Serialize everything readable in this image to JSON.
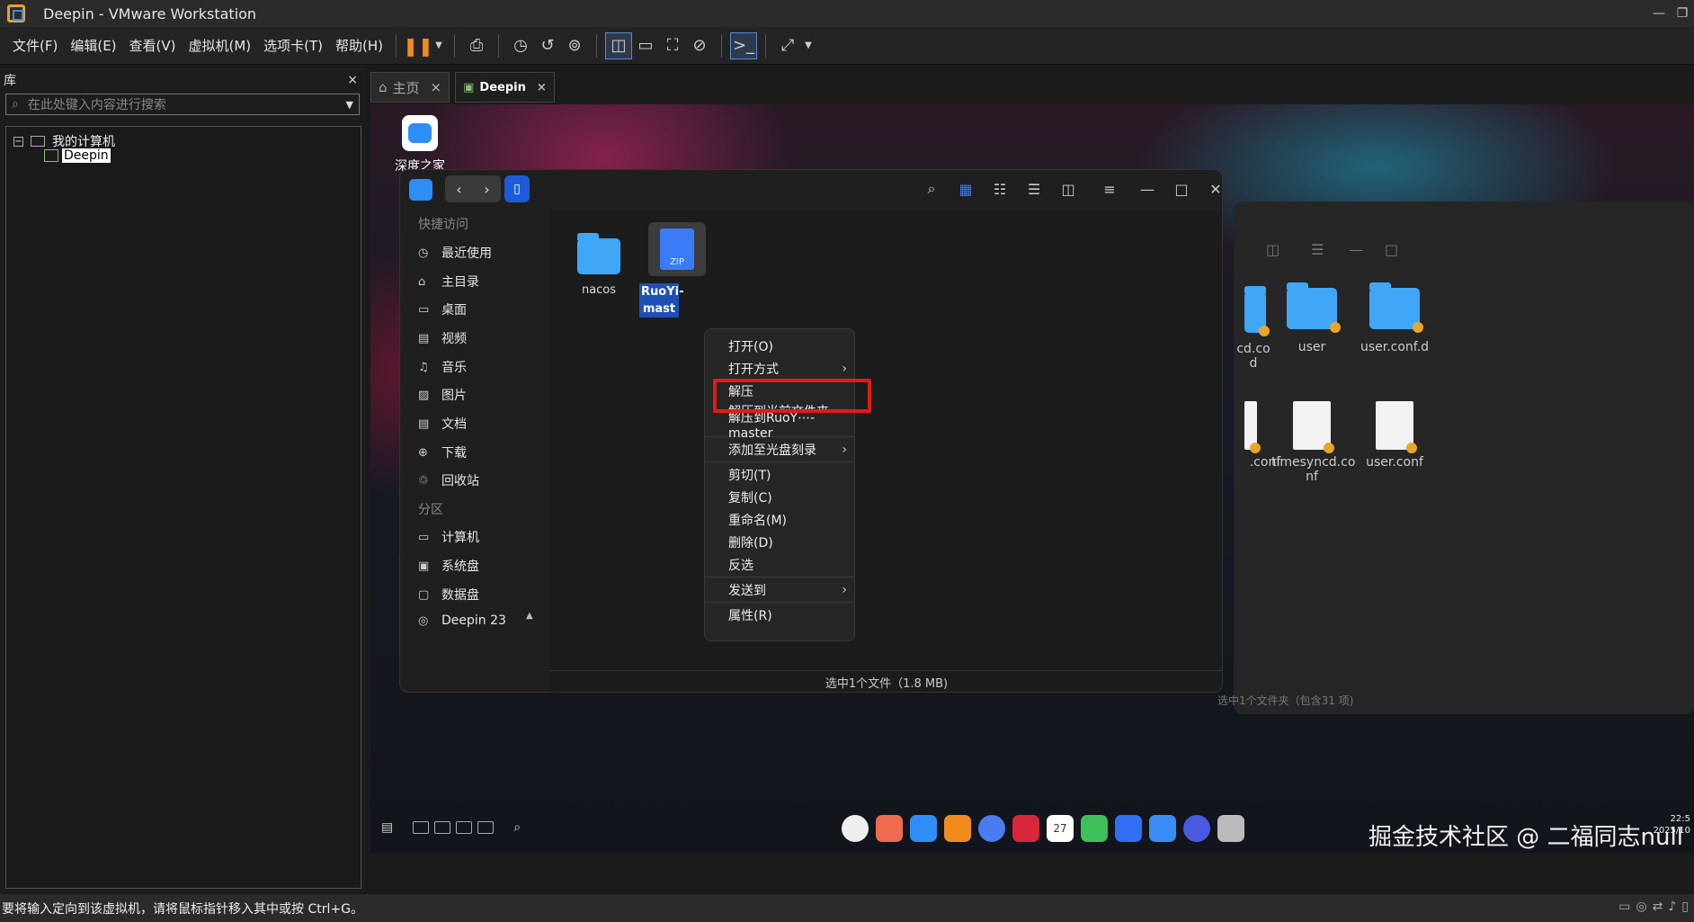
{
  "window": {
    "title": "Deepin - VMware Workstation"
  },
  "menubar": {
    "items": [
      "文件(F)",
      "编辑(E)",
      "查看(V)",
      "虚拟机(M)",
      "选项卡(T)",
      "帮助(H)"
    ]
  },
  "library": {
    "title": "库",
    "close": "×",
    "search_placeholder": "在此处键入内容进行搜索",
    "tree": {
      "root": "我的计算机",
      "root_toggle": "−",
      "vm": "Deepin"
    }
  },
  "tabs": [
    {
      "label": "主页",
      "close": "×"
    },
    {
      "label": "Deepin",
      "close": "×"
    }
  ],
  "desktop": {
    "icon_label": "深度之家"
  },
  "file_manager": {
    "sidebar": {
      "quick_header": "快捷访问",
      "quick": [
        "最近使用",
        "主目录",
        "桌面",
        "视频",
        "音乐",
        "图片",
        "文档",
        "下载",
        "回收站"
      ],
      "partition_header": "分区",
      "partitions": [
        "计算机",
        "系统盘",
        "数据盘",
        "Deepin 23"
      ]
    },
    "files": [
      {
        "name": "nacos"
      },
      {
        "name": "RuoYi-",
        "name2": "mast",
        "type": "ZIP"
      }
    ],
    "status": "选中1个文件（1.8 MB)"
  },
  "context_menu": {
    "items": [
      "打开(O)",
      "打开方式",
      "解压",
      "解压到当前文件夹",
      "解压到RuoY⋯-master",
      "添加至光盘刻录",
      "剪切(T)",
      "复制(C)",
      "重命名(M)",
      "删除(D)",
      "反选",
      "发送到",
      "属性(R)"
    ]
  },
  "bg_file_manager": {
    "items": [
      {
        "label": "cd.co",
        "label2": "d"
      },
      {
        "label": "user"
      },
      {
        "label": "user.conf.d"
      },
      {
        "label": ".conf"
      },
      {
        "label": "timesyncd.co",
        "label2": "nf"
      },
      {
        "label": "user.conf"
      }
    ],
    "status": "选中1个文件夹（包含31 项)"
  },
  "dock": {
    "watermark": "掘金技术社区 @ 二福同志null",
    "time": "22:5",
    "date": "2025/10",
    "calendar_day": "27"
  },
  "statusbar": {
    "text": "要将输入定向到该虚拟机，请将鼠标指针移入其中或按 Ctrl+G。"
  },
  "colors": {
    "highlight": "#e11b1b",
    "accent": "#2f8ef5",
    "folder": "#3fa7f5",
    "pause": "#f08c1c"
  }
}
